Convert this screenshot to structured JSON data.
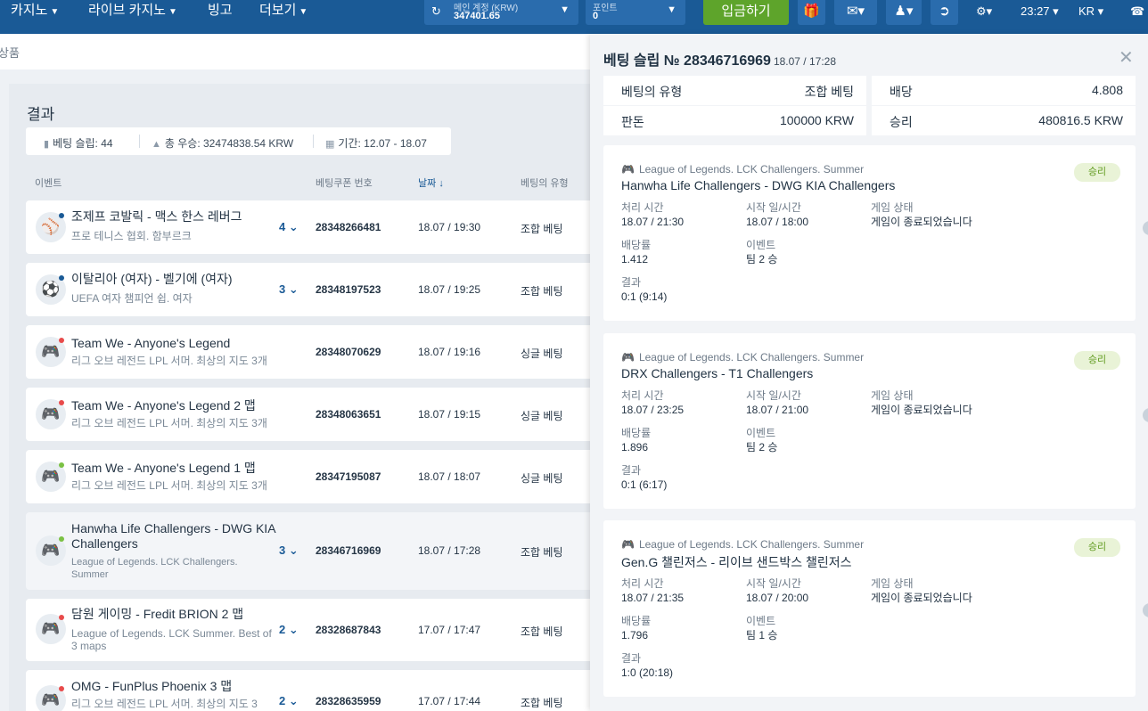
{
  "nav": {
    "casino": "카지노",
    "live_casino": "라이브 카지노",
    "bingo": "빙고",
    "more": "더보기",
    "account_label": "메인 계정 (KRW)",
    "account_value": "347401.65",
    "points_label": "포인트",
    "points_value": "0",
    "deposit": "입금하기",
    "time": "23:27",
    "lang": "KR"
  },
  "breadcrumb": "상품",
  "results": {
    "title": "결과",
    "stats": {
      "slips": "베팅 슬립: 44",
      "winnings": "총 우승: 32474838.54 KRW",
      "period": "기간: 12.07 - 18.07"
    },
    "columns": {
      "event": "이벤트",
      "coupon": "베팅쿠폰 번호",
      "date": "날짜",
      "type": "베팅의 유형"
    },
    "rows": [
      {
        "name": "조제프 코발릭 - 맥스 한스 레버그",
        "sub": "프로 테니스 협회. 함부르크",
        "count": "4",
        "id": "28348266481",
        "date": "18.07 / 19:30",
        "type": "조합 베팅",
        "icon": "tennis-icon",
        "dot": "#1a5a96"
      },
      {
        "name": "이탈리아 (여자) - 벨기에 (여자)",
        "sub": "UEFA 여자 챔피언 쉽. 여자",
        "count": "3",
        "id": "28348197523",
        "date": "18.07 / 19:25",
        "type": "조합 베팅",
        "icon": "football-icon",
        "dot": "#1a5a96"
      },
      {
        "name": "Team We - Anyone's Legend",
        "sub": "리그 오브 레전드 LPL 서머. 최상의 지도 3개",
        "count": "",
        "id": "28348070629",
        "date": "18.07 / 19:16",
        "type": "싱글 베팅",
        "icon": "gamepad-icon",
        "dot": "#e84b4b"
      },
      {
        "name": "Team We - Anyone's Legend 2 맵",
        "sub": "리그 오브 레전드 LPL 서머. 최상의 지도 3개",
        "count": "",
        "id": "28348063651",
        "date": "18.07 / 19:15",
        "type": "싱글 베팅",
        "icon": "gamepad-icon",
        "dot": "#e84b4b"
      },
      {
        "name": "Team We - Anyone's Legend 1 맵",
        "sub": "리그 오브 레전드 LPL 서머. 최상의 지도 3개",
        "count": "",
        "id": "28347195087",
        "date": "18.07 / 18:07",
        "type": "싱글 베팅",
        "icon": "gamepad-icon",
        "dot": "#7bc144"
      },
      {
        "name": "Hanwha Life Challengers - DWG KIA Challengers",
        "sub": "League of Legends. LCK Challengers. Summer",
        "count": "3",
        "id": "28346716969",
        "date": "18.07 / 17:28",
        "type": "조합 베팅",
        "icon": "gamepad-icon",
        "dot": "#7bc144"
      },
      {
        "name": "담원 게이밍 - Fredit BRION 2 맵",
        "sub": "League of Legends. LCK Summer. Best of 3 maps",
        "count": "2",
        "id": "28328687843",
        "date": "17.07 / 17:47",
        "type": "조합 베팅",
        "icon": "gamepad-icon",
        "dot": "#e84b4b"
      },
      {
        "name": "OMG - FunPlus Phoenix 3 맵",
        "sub": "리그 오브 레전드 LPL 서머. 최상의 지도 3",
        "count": "2",
        "id": "28328635959",
        "date": "17.07 / 17:44",
        "type": "조합 베팅",
        "icon": "gamepad-icon",
        "dot": "#e84b4b"
      }
    ]
  },
  "slip": {
    "title": "베팅 슬립 № 28346716969",
    "datetime": "18.07 / 17:28",
    "summary": {
      "type_label": "베팅의 유형",
      "type_value": "조합 베팅",
      "odds_label": "배당",
      "odds_value": "4.808",
      "stake_label": "판돈",
      "stake_value": "100000 KRW",
      "win_label": "승리",
      "win_value": "480816.5 KRW"
    },
    "field_labels": {
      "processed": "처리 시간",
      "start": "시작 일/시간",
      "status": "게임 상태",
      "odds": "배당률",
      "event": "이벤트",
      "result": "결과"
    },
    "cards": [
      {
        "league": "League of Legends. LCK Challengers. Summer",
        "match": "Hanwha Life Challengers - DWG KIA Challengers",
        "badge": "승리",
        "processed": "18.07 / 21:30",
        "start": "18.07 / 18:00",
        "status": "게임이 종료되었습니다",
        "odds": "1.412",
        "event": "팀 2 승",
        "result": "0:1 (9:14)"
      },
      {
        "league": "League of Legends. LCK Challengers. Summer",
        "match": "DRX Challengers - T1 Challengers",
        "badge": "승리",
        "processed": "18.07 / 23:25",
        "start": "18.07 / 21:00",
        "status": "게임이 종료되었습니다",
        "odds": "1.896",
        "event": "팀 2 승",
        "result": "0:1 (6:17)"
      },
      {
        "league": "League of Legends. LCK Challengers. Summer",
        "match": "Gen.G 챌린저스 - 리이브 샌드박스 챌린저스",
        "badge": "승리",
        "processed": "18.07 / 21:35",
        "start": "18.07 / 20:00",
        "status": "게임이 종료되었습니다",
        "odds": "1.796",
        "event": "팀 1 승",
        "result": "1:0 (20:18)"
      }
    ]
  }
}
